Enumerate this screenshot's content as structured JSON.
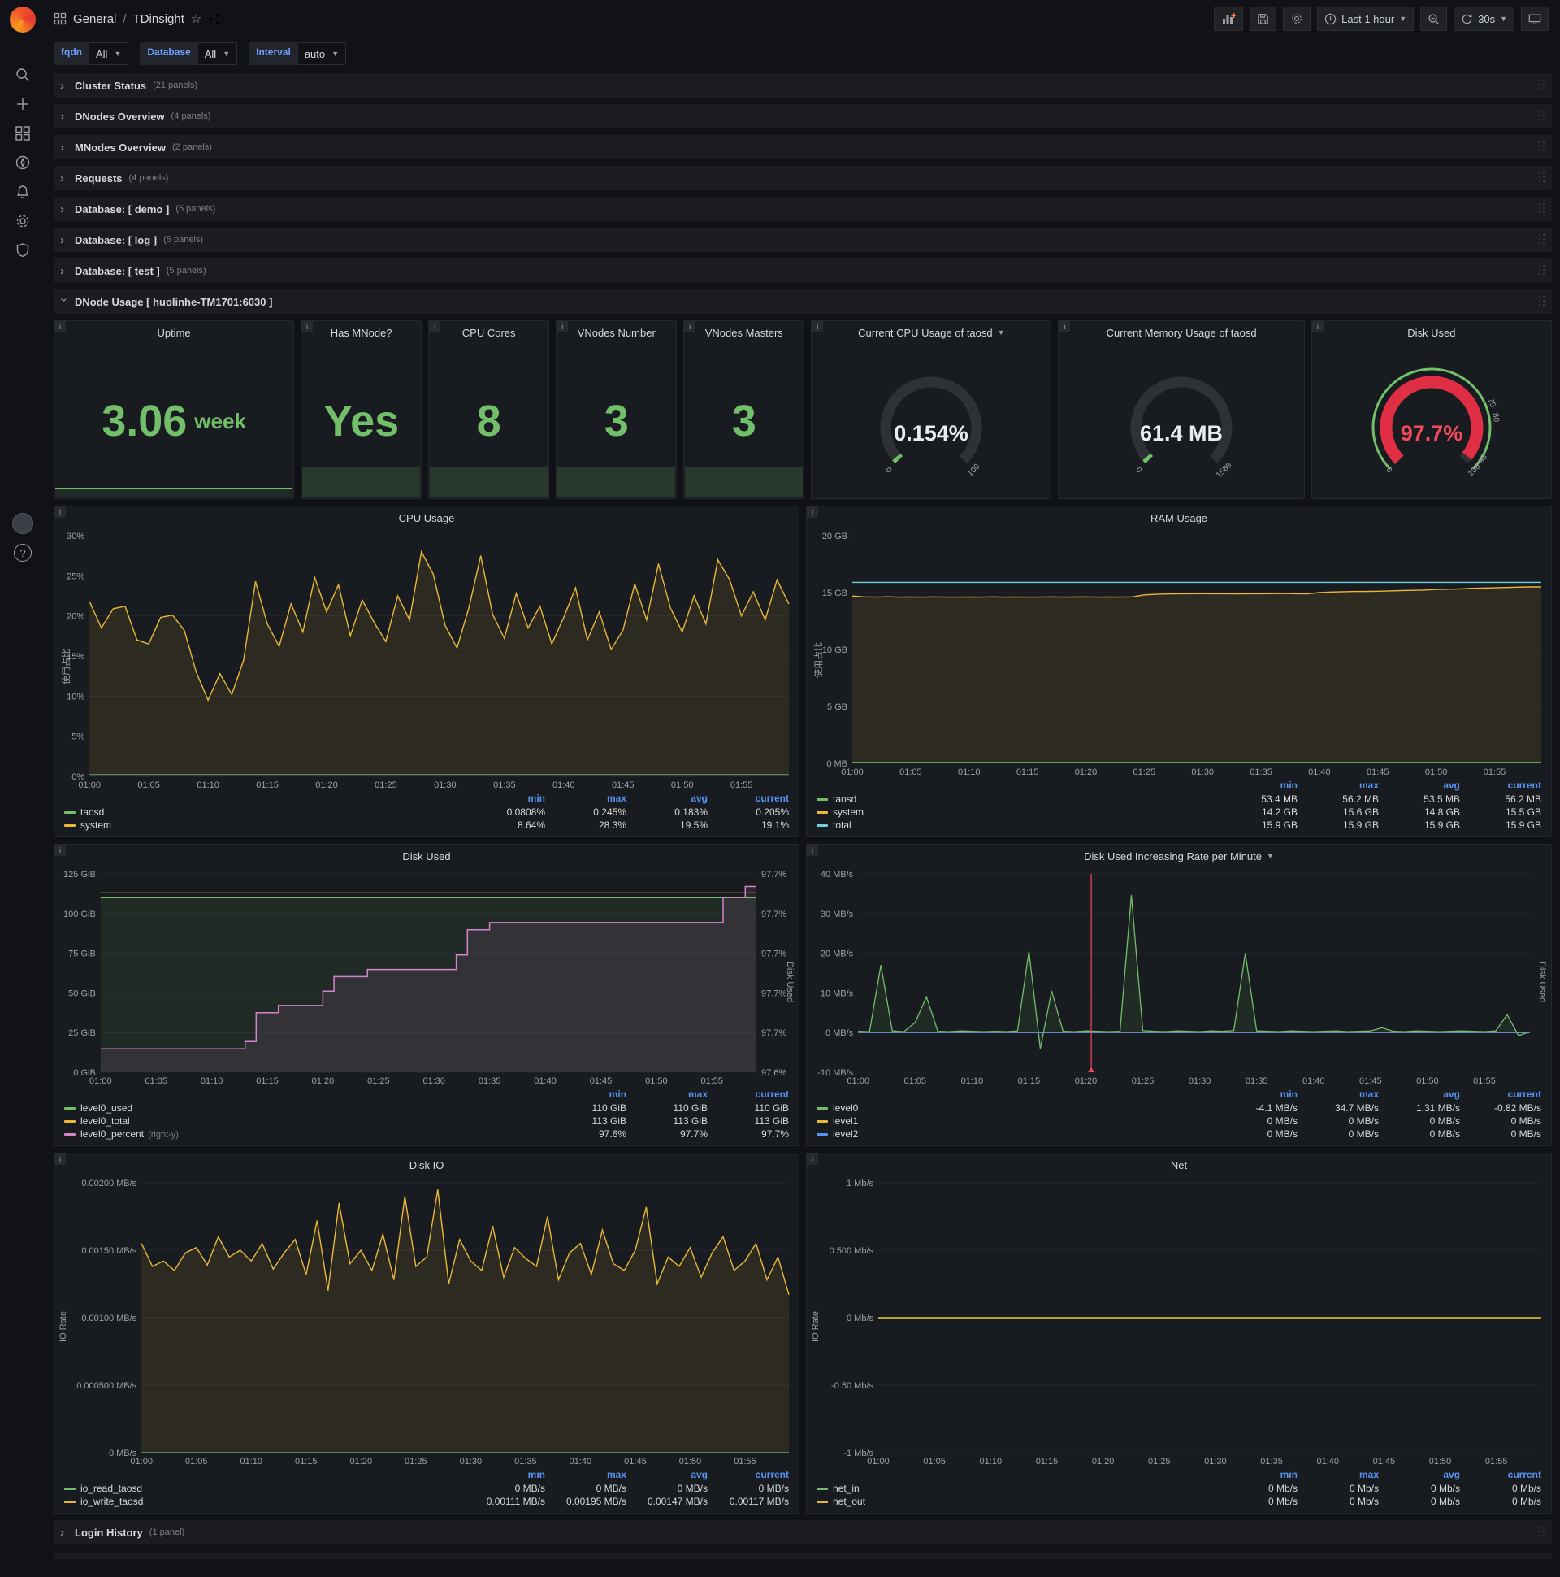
{
  "topnav": {
    "section": "General",
    "separator": "/",
    "title": "TDinsight",
    "time_range": "Last 1 hour",
    "refresh_interval": "30s"
  },
  "variables": [
    {
      "label": "fqdn",
      "value": "All"
    },
    {
      "label": "Database",
      "value": "All"
    }
  ],
  "interval": {
    "label": "Interval",
    "value": "auto"
  },
  "rows": [
    {
      "title": "Cluster Status",
      "count": "(21 panels)"
    },
    {
      "title": "DNodes Overview",
      "count": "(4 panels)"
    },
    {
      "title": "MNodes Overview",
      "count": "(2 panels)"
    },
    {
      "title": "Requests",
      "count": "(4 panels)"
    },
    {
      "title": "Database: [ demo ]",
      "count": "(5 panels)"
    },
    {
      "title": "Database: [ log ]",
      "count": "(5 panels)"
    },
    {
      "title": "Database: [ test ]",
      "count": "(5 panels)"
    }
  ],
  "expanded_row": {
    "title": "DNode Usage [ huolinhe-TM1701:6030 ]"
  },
  "bottom_row": {
    "title": "Login History",
    "count": "(1 panel)"
  },
  "stats": [
    {
      "title": "Uptime",
      "value": "3.06",
      "unit": "week",
      "spark": "thin"
    },
    {
      "title": "Has MNode?",
      "value": "Yes",
      "spark": "full"
    },
    {
      "title": "CPU Cores",
      "value": "8",
      "spark": "full"
    },
    {
      "title": "VNodes Number",
      "value": "3",
      "spark": "full"
    },
    {
      "title": "VNodes Masters",
      "value": "3",
      "spark": "full"
    }
  ],
  "gauges": [
    {
      "title": "Current CPU Usage of taosd",
      "menu": true,
      "value": "0.154%",
      "pct": 0.154,
      "value_color": "#E9EDF2",
      "arc_color": "#73BF69",
      "outer_ring": false,
      "ticks": [
        {
          "t": 0,
          "label": "0"
        },
        {
          "t": 1,
          "label": "100"
        }
      ]
    },
    {
      "title": "Current Memory Usage of taosd",
      "menu": false,
      "value": "61.4 MB",
      "pct": 0.39,
      "value_color": "#E9EDF2",
      "arc_color": "#73BF69",
      "outer_ring": false,
      "ticks": [
        {
          "t": 0,
          "label": "0"
        },
        {
          "t": 1,
          "label": "1589"
        }
      ]
    },
    {
      "title": "Disk Used",
      "menu": false,
      "value": "97.7%",
      "pct": 97.7,
      "value_color": "#F2495C",
      "arc_color": "#E02F44",
      "outer_ring": true,
      "ticks": [
        {
          "t": 0,
          "label": "0"
        },
        {
          "t": 0.75,
          "label": "75"
        },
        {
          "t": 0.8,
          "label": "80"
        },
        {
          "t": 0.95,
          "label": "95"
        },
        {
          "t": 1,
          "label": "100"
        }
      ]
    }
  ],
  "chart_data": [
    {
      "id": "cpu-usage",
      "type": "line",
      "title": "CPU Usage",
      "ylabel": "使用占比",
      "y_min": 0,
      "y_max": 30,
      "y_ticks": [
        {
          "v": 0,
          "label": "0%"
        },
        {
          "v": 5,
          "label": "5%"
        },
        {
          "v": 10,
          "label": "10%"
        },
        {
          "v": 15,
          "label": "15%"
        },
        {
          "v": 20,
          "label": "20%"
        },
        {
          "v": 25,
          "label": "25%"
        },
        {
          "v": 30,
          "label": "30%"
        }
      ],
      "x_labels": [
        "01:00",
        "01:05",
        "01:10",
        "01:15",
        "01:20",
        "01:25",
        "01:30",
        "01:35",
        "01:40",
        "01:45",
        "01:50",
        "01:55"
      ],
      "series": [
        {
          "name": "system",
          "color": "#EAB839",
          "fill": true,
          "width": 1.4,
          "values": [
            21.8,
            18.5,
            20.9,
            21.2,
            17.0,
            16.5,
            19.8,
            20.1,
            18.2,
            13.0,
            9.5,
            12.8,
            10.2,
            14.5,
            24.3,
            19.0,
            16.2,
            21.5,
            18.0,
            24.8,
            20.5,
            23.9,
            17.5,
            22.0,
            19.2,
            16.8,
            22.5,
            19.5,
            28.0,
            25.2,
            18.8,
            16.0,
            21.0,
            27.5,
            20.2,
            17.2,
            22.8,
            18.5,
            21.2,
            16.5,
            19.8,
            23.5,
            17.0,
            20.5,
            15.8,
            18.2,
            24.0,
            19.5,
            26.5,
            21.0,
            18.0,
            22.5,
            19.0,
            27.0,
            24.5,
            20.0,
            23.0,
            19.5,
            24.5,
            21.5
          ]
        },
        {
          "name": "taosd",
          "color": "#73BF69",
          "fill": true,
          "width": 1.2,
          "value": 0.2
        }
      ],
      "legend_cols": [
        "min",
        "max",
        "avg",
        "current"
      ],
      "legend_rows": [
        {
          "name": "taosd",
          "color": "#73BF69",
          "vals": [
            "0.0808%",
            "0.245%",
            "0.183%",
            "0.205%"
          ]
        },
        {
          "name": "system",
          "color": "#EAB839",
          "vals": [
            "8.64%",
            "28.3%",
            "19.5%",
            "19.1%"
          ]
        }
      ]
    },
    {
      "id": "ram-usage",
      "type": "line",
      "title": "RAM Usage",
      "ylabel": "使用占比",
      "y_min": 0,
      "y_max": 20,
      "y_ticks": [
        {
          "v": 0,
          "label": "0 MB"
        },
        {
          "v": 5,
          "label": "5 GB"
        },
        {
          "v": 10,
          "label": "10 GB"
        },
        {
          "v": 15,
          "label": "15 GB"
        },
        {
          "v": 20,
          "label": "20 GB"
        }
      ],
      "x_labels": [
        "01:00",
        "01:05",
        "01:10",
        "01:15",
        "01:20",
        "01:25",
        "01:30",
        "01:35",
        "01:40",
        "01:45",
        "01:50",
        "01:55"
      ],
      "series": [
        {
          "name": "system",
          "color": "#EAB839",
          "fill": true,
          "width": 1.4,
          "values": [
            14.7,
            14.62,
            14.6,
            14.63,
            14.6,
            14.61,
            14.6,
            14.62,
            14.6,
            14.6,
            14.61,
            14.6,
            14.62,
            14.6,
            14.61,
            14.6,
            14.6,
            14.62,
            14.6,
            14.61,
            14.62,
            14.6,
            14.61,
            14.6,
            14.62,
            14.8,
            14.85,
            14.88,
            14.9,
            14.9,
            14.91,
            14.9,
            14.9,
            14.89,
            14.9,
            14.9,
            14.91,
            14.93,
            14.9,
            14.9,
            15.0,
            15.05,
            15.08,
            15.1,
            15.1,
            15.12,
            15.15,
            15.18,
            15.2,
            15.22,
            15.28,
            15.3,
            15.32,
            15.38,
            15.4,
            15.42,
            15.45,
            15.48,
            15.5,
            15.5
          ]
        },
        {
          "name": "total",
          "color": "#6ED0E0",
          "fill": false,
          "width": 1.4,
          "value": 15.9
        },
        {
          "name": "taosd",
          "color": "#73BF69",
          "fill": false,
          "width": 1.2,
          "value": 0.055
        }
      ],
      "legend_cols": [
        "min",
        "max",
        "avg",
        "current"
      ],
      "legend_rows": [
        {
          "name": "taosd",
          "color": "#73BF69",
          "vals": [
            "53.4 MB",
            "56.2 MB",
            "53.5 MB",
            "56.2 MB"
          ]
        },
        {
          "name": "system",
          "color": "#EAB839",
          "vals": [
            "14.2 GB",
            "15.6 GB",
            "14.8 GB",
            "15.5 GB"
          ]
        },
        {
          "name": "total",
          "color": "#6ED0E0",
          "vals": [
            "15.9 GB",
            "15.9 GB",
            "15.9 GB",
            "15.9 GB"
          ]
        }
      ]
    },
    {
      "id": "disk-used",
      "type": "line",
      "title": "Disk Used",
      "y_min": 0,
      "y_max": 125,
      "y_ticks": [
        {
          "v": 0,
          "label": "0 GiB"
        },
        {
          "v": 25,
          "label": "25 GiB"
        },
        {
          "v": 50,
          "label": "50 GiB"
        },
        {
          "v": 75,
          "label": "75 GiB"
        },
        {
          "v": 100,
          "label": "100 GiB"
        },
        {
          "v": 125,
          "label": "125 GiB"
        }
      ],
      "x_labels": [
        "01:00",
        "01:05",
        "01:10",
        "01:15",
        "01:20",
        "01:25",
        "01:30",
        "01:35",
        "01:40",
        "01:45",
        "01:50",
        "01:55"
      ],
      "right": {
        "min": 97.595,
        "max": 97.705,
        "label": "Disk Used",
        "tick_labels": [
          "97.6%",
          "97.7%",
          "97.7%",
          "97.7%",
          "97.7%",
          "97.7%"
        ]
      },
      "series": [
        {
          "name": "level0_used",
          "color": "#73BF69",
          "fill": true,
          "width": 1.3,
          "value": 110
        },
        {
          "name": "level0_total",
          "color": "#EAB839",
          "fill": false,
          "width": 1.3,
          "value": 113
        },
        {
          "name": "level0_percent",
          "color": "#D683CE",
          "fill": true,
          "width": 1.5,
          "axis": "right",
          "step": true,
          "values": [
            97.608,
            97.608,
            97.608,
            97.608,
            97.608,
            97.608,
            97.608,
            97.608,
            97.608,
            97.608,
            97.608,
            97.608,
            97.608,
            97.612,
            97.628,
            97.628,
            97.632,
            97.632,
            97.632,
            97.632,
            97.64,
            97.648,
            97.648,
            97.648,
            97.652,
            97.652,
            97.652,
            97.652,
            97.652,
            97.652,
            97.652,
            97.652,
            97.66,
            97.674,
            97.674,
            97.678,
            97.678,
            97.678,
            97.678,
            97.678,
            97.678,
            97.678,
            97.678,
            97.678,
            97.678,
            97.678,
            97.678,
            97.678,
            97.678,
            97.678,
            97.678,
            97.678,
            97.678,
            97.678,
            97.678,
            97.678,
            97.692,
            97.692,
            97.698,
            97.698
          ]
        }
      ],
      "legend_cols": [
        "min",
        "max",
        "current"
      ],
      "legend_rows": [
        {
          "name": "level0_used",
          "color": "#73BF69",
          "vals": [
            "110 GiB",
            "110 GiB",
            "110 GiB"
          ]
        },
        {
          "name": "level0_total",
          "color": "#EAB839",
          "vals": [
            "113 GiB",
            "113 GiB",
            "113 GiB"
          ]
        },
        {
          "name": "level0_percent",
          "color": "#D683CE",
          "suffix": "(right-y)",
          "vals": [
            "97.6%",
            "97.7%",
            "97.7%"
          ]
        }
      ]
    },
    {
      "id": "disk-used-rate",
      "type": "line",
      "title": "Disk Used Increasing Rate per Minute",
      "menu": true,
      "y_min": -10,
      "y_max": 40,
      "y_ticks": [
        {
          "v": -10,
          "label": "-10 MB/s"
        },
        {
          "v": 0,
          "label": "0 MB/s"
        },
        {
          "v": 10,
          "label": "10 MB/s"
        },
        {
          "v": 20,
          "label": "20 MB/s"
        },
        {
          "v": 30,
          "label": "30 MB/s"
        },
        {
          "v": 40,
          "label": "40 MB/s"
        }
      ],
      "x_labels": [
        "01:00",
        "01:05",
        "01:10",
        "01:15",
        "01:20",
        "01:25",
        "01:30",
        "01:35",
        "01:40",
        "01:45",
        "01:50",
        "01:55"
      ],
      "right": {
        "label": "Disk Used"
      },
      "annotation": {
        "x_frac": 0.347,
        "color": "#F2495C"
      },
      "series": [
        {
          "name": "level0",
          "color": "#73BF69",
          "fill": true,
          "width": 1.3,
          "values": [
            0.3,
            0.2,
            17,
            0.4,
            0.2,
            2.5,
            9,
            0.3,
            0.2,
            0.4,
            0.3,
            0.2,
            0.3,
            0.2,
            0.4,
            20.5,
            -4.1,
            10.5,
            0.3,
            0.2,
            0.4,
            0.3,
            0.2,
            0.3,
            34.7,
            0.5,
            0.3,
            0.2,
            0.4,
            0.3,
            0.2,
            0.4,
            0.3,
            0.5,
            20,
            0.4,
            0.3,
            0.2,
            0.4,
            0.3,
            0.2,
            0.3,
            0.4,
            0.2,
            0.3,
            0.4,
            1.2,
            0.3,
            0.2,
            0.4,
            0.3,
            0.2,
            0.3,
            0.4,
            0.3,
            0.2,
            0.4,
            4.5,
            -0.8,
            0.2
          ]
        },
        {
          "name": "level1",
          "color": "#EAB839",
          "fill": false,
          "width": 1.2,
          "value": 0
        },
        {
          "name": "level2",
          "color": "#5794F2",
          "fill": false,
          "width": 1.2,
          "value": 0
        }
      ],
      "legend_cols": [
        "min",
        "max",
        "avg",
        "current"
      ],
      "legend_rows": [
        {
          "name": "level0",
          "color": "#73BF69",
          "vals": [
            "-4.1 MB/s",
            "34.7 MB/s",
            "1.31 MB/s",
            "-0.82 MB/s"
          ]
        },
        {
          "name": "level1",
          "color": "#EAB839",
          "vals": [
            "0 MB/s",
            "0 MB/s",
            "0 MB/s",
            "0 MB/s"
          ]
        },
        {
          "name": "level2",
          "color": "#5794F2",
          "vals": [
            "0 MB/s",
            "0 MB/s",
            "0 MB/s",
            "0 MB/s"
          ]
        }
      ]
    },
    {
      "id": "disk-io",
      "type": "line",
      "title": "Disk IO",
      "ylabel": "IO Rate",
      "y_min": 0,
      "y_max": 0.002,
      "y_ticks": [
        {
          "v": 0,
          "label": "0 MB/s"
        },
        {
          "v": 0.0005,
          "label": "0.000500 MB/s"
        },
        {
          "v": 0.001,
          "label": "0.00100 MB/s"
        },
        {
          "v": 0.0015,
          "label": "0.00150 MB/s"
        },
        {
          "v": 0.002,
          "label": "0.00200 MB/s"
        }
      ],
      "x_labels": [
        "01:00",
        "01:05",
        "01:10",
        "01:15",
        "01:20",
        "01:25",
        "01:30",
        "01:35",
        "01:40",
        "01:45",
        "01:50",
        "01:55"
      ],
      "series": [
        {
          "name": "io_write_taosd",
          "color": "#EAB839",
          "fill": true,
          "width": 1.4,
          "values": [
            0.00155,
            0.00138,
            0.00142,
            0.00135,
            0.00148,
            0.00152,
            0.00139,
            0.0016,
            0.00145,
            0.0015,
            0.00142,
            0.00155,
            0.00136,
            0.00148,
            0.00158,
            0.00132,
            0.00172,
            0.0012,
            0.00185,
            0.0014,
            0.0015,
            0.00135,
            0.00162,
            0.00128,
            0.0019,
            0.00138,
            0.00145,
            0.00195,
            0.00125,
            0.00158,
            0.00142,
            0.00135,
            0.00168,
            0.0013,
            0.00152,
            0.00144,
            0.00138,
            0.00175,
            0.00128,
            0.00148,
            0.00155,
            0.00132,
            0.00165,
            0.0014,
            0.00135,
            0.0015,
            0.00182,
            0.00125,
            0.00145,
            0.00138,
            0.00152,
            0.0013,
            0.00148,
            0.0016,
            0.00135,
            0.00142,
            0.00155,
            0.00128,
            0.00145,
            0.00117
          ]
        },
        {
          "name": "io_read_taosd",
          "color": "#73BF69",
          "fill": false,
          "width": 1.2,
          "value": 0
        }
      ],
      "legend_cols": [
        "min",
        "max",
        "avg",
        "current"
      ],
      "legend_rows": [
        {
          "name": "io_read_taosd",
          "color": "#73BF69",
          "vals": [
            "0 MB/s",
            "0 MB/s",
            "0 MB/s",
            "0 MB/s"
          ]
        },
        {
          "name": "io_write_taosd",
          "color": "#EAB839",
          "vals": [
            "0.00111 MB/s",
            "0.00195 MB/s",
            "0.00147 MB/s",
            "0.00117 MB/s"
          ]
        }
      ]
    },
    {
      "id": "net",
      "type": "line",
      "title": "Net",
      "ylabel": "IO Rate",
      "y_min": -1,
      "y_max": 1,
      "y_ticks": [
        {
          "v": -1,
          "label": "-1 Mb/s"
        },
        {
          "v": -0.5,
          "label": "-0.50 Mb/s"
        },
        {
          "v": 0,
          "label": "0 Mb/s"
        },
        {
          "v": 0.5,
          "label": "0.500 Mb/s"
        },
        {
          "v": 1,
          "label": "1 Mb/s"
        }
      ],
      "x_labels": [
        "01:00",
        "01:05",
        "01:10",
        "01:15",
        "01:20",
        "01:25",
        "01:30",
        "01:35",
        "01:40",
        "01:45",
        "01:50",
        "01:55"
      ],
      "series": [
        {
          "name": "net_in",
          "color": "#73BF69",
          "fill": false,
          "width": 1.2,
          "value": 0
        },
        {
          "name": "net_out",
          "color": "#EAB839",
          "fill": false,
          "width": 1.4,
          "value": 0
        }
      ],
      "legend_cols": [
        "min",
        "max",
        "avg",
        "current"
      ],
      "legend_rows": [
        {
          "name": "net_in",
          "color": "#73BF69",
          "vals": [
            "0 Mb/s",
            "0 Mb/s",
            "0 Mb/s",
            "0 Mb/s"
          ]
        },
        {
          "name": "net_out",
          "color": "#EAB839",
          "vals": [
            "0 Mb/s",
            "0 Mb/s",
            "0 Mb/s",
            "0 Mb/s"
          ]
        }
      ]
    }
  ]
}
